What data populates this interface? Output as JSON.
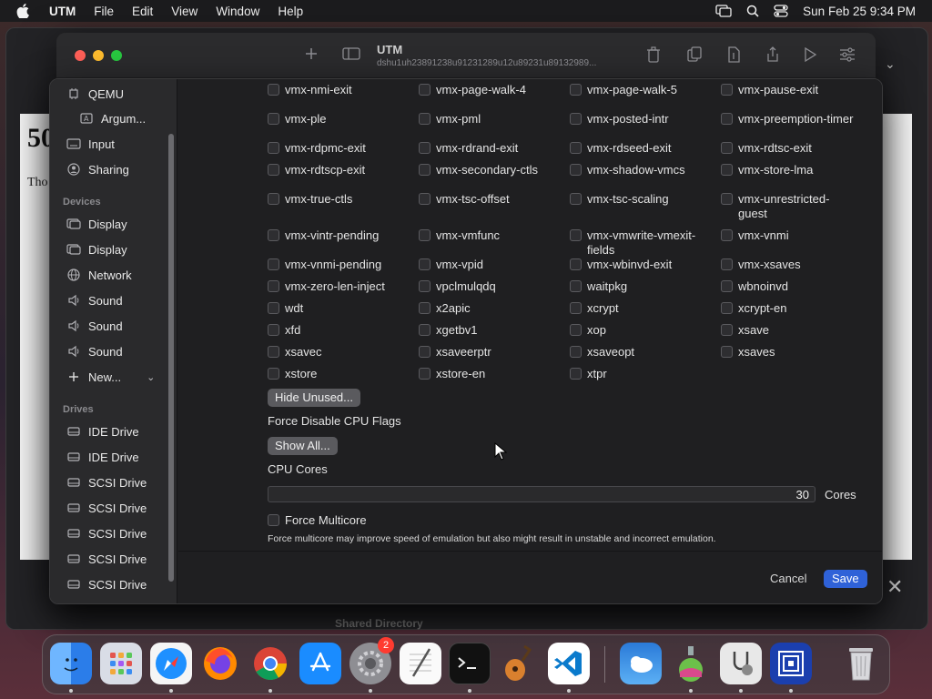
{
  "menubar": {
    "app": "UTM",
    "items": [
      "File",
      "Edit",
      "View",
      "Window",
      "Help"
    ],
    "clock": "Sun Feb 25  9:34 PM"
  },
  "background": {
    "heading": "50",
    "paragraph": "Tho",
    "strip_label": "Shared Directory"
  },
  "window": {
    "title": "UTM",
    "subtitle": "dshu1uh23891238u91231289u12u89231u89132989..."
  },
  "sidebar": {
    "top_items": [
      {
        "label": "QEMU",
        "icon": "cpu-icon"
      },
      {
        "label": "Argum...",
        "icon": "arguments-icon"
      },
      {
        "label": "Input",
        "icon": "keyboard-icon"
      },
      {
        "label": "Sharing",
        "icon": "person-icon"
      }
    ],
    "devices_header": "Devices",
    "devices": [
      {
        "label": "Display",
        "icon": "display-icon"
      },
      {
        "label": "Display",
        "icon": "display-icon"
      },
      {
        "label": "Network",
        "icon": "globe-icon"
      },
      {
        "label": "Sound",
        "icon": "speaker-icon"
      },
      {
        "label": "Sound",
        "icon": "speaker-icon"
      },
      {
        "label": "Sound",
        "icon": "speaker-icon"
      },
      {
        "label": "New...",
        "icon": "plus-icon"
      }
    ],
    "drives_header": "Drives",
    "drives": [
      "IDE Drive",
      "IDE Drive",
      "SCSI Drive",
      "SCSI Drive",
      "SCSI Drive",
      "SCSI Drive",
      "SCSI Drive"
    ]
  },
  "cpu_flags": [
    "vmx-nmi-exit",
    "vmx-page-walk-4",
    "vmx-page-walk-5",
    "vmx-pause-exit",
    "vmx-ple",
    "vmx-pml",
    "vmx-posted-intr",
    "vmx-preemption-timer",
    "vmx-rdpmc-exit",
    "vmx-rdrand-exit",
    "vmx-rdseed-exit",
    "vmx-rdtsc-exit",
    "vmx-rdtscp-exit",
    "vmx-secondary-ctls",
    "vmx-shadow-vmcs",
    "vmx-store-lma",
    "vmx-true-ctls",
    "vmx-tsc-offset",
    "vmx-tsc-scaling",
    "vmx-unrestricted-guest",
    "vmx-vintr-pending",
    "vmx-vmfunc",
    "vmx-vmwrite-vmexit-fields",
    "vmx-vnmi",
    "vmx-vnmi-pending",
    "vmx-vpid",
    "vmx-wbinvd-exit",
    "vmx-xsaves",
    "vmx-zero-len-inject",
    "vpclmulqdq",
    "waitpkg",
    "wbnoinvd",
    "wdt",
    "x2apic",
    "xcrypt",
    "xcrypt-en",
    "xfd",
    "xgetbv1",
    "xop",
    "xsave",
    "xsavec",
    "xsaveerptr",
    "xsaveopt",
    "xsaves",
    "xstore",
    "xstore-en",
    "xtpr"
  ],
  "content": {
    "hide_unused": "Hide Unused...",
    "force_disable_label": "Force Disable CPU Flags",
    "show_all": "Show All...",
    "cpu_cores_label": "CPU Cores",
    "cpu_cores_value": "30",
    "cores_unit": "Cores",
    "force_multicore": "Force Multicore",
    "multicore_hint": "Force multicore may improve speed of emulation but also might result in unstable and incorrect emulation."
  },
  "footer": {
    "cancel": "Cancel",
    "save": "Save"
  },
  "dock": {
    "apps": [
      "Finder",
      "Launchpad",
      "Safari",
      "Firefox",
      "Chrome",
      "App Store",
      "System Settings",
      "TextEdit",
      "Terminal",
      "GarageBand",
      "VS Code",
      "Weather",
      "Preview",
      "Disk Utility",
      "UTM",
      "Trash"
    ],
    "settings_badge": "2"
  },
  "colors": {
    "accent": "#2f62d8",
    "sheet_bg": "#1f1f21",
    "sidebar_bg": "#2a2a2c"
  }
}
